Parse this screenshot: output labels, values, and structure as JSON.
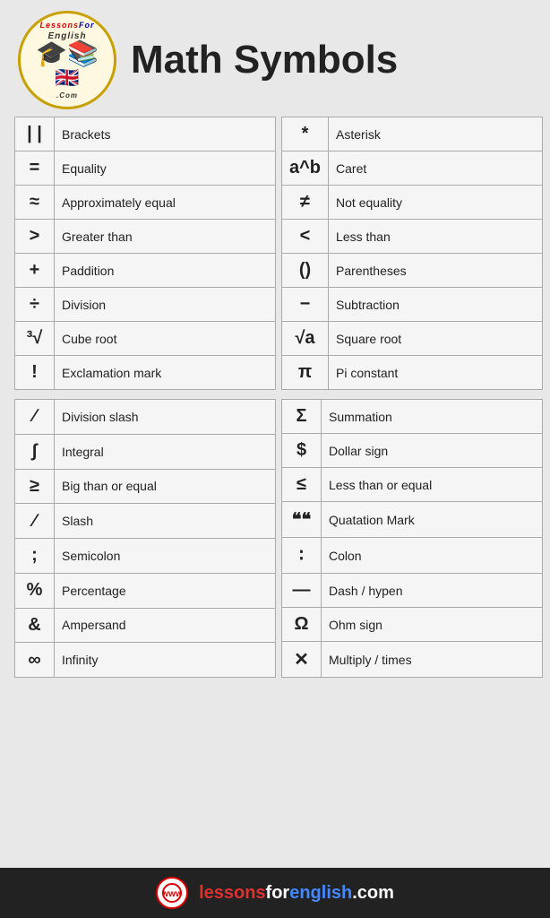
{
  "header": {
    "title": "Math Symbols",
    "logo_top": "LessonsFor",
    "logo_top2": "English",
    "logo_bottom": ".Com"
  },
  "table1_left": [
    {
      "symbol": "| |",
      "name": "Brackets"
    },
    {
      "symbol": "=",
      "name": "Equality"
    },
    {
      "symbol": "≈",
      "name": "Approximately equal"
    },
    {
      "symbol": ">",
      "name": "Greater than"
    },
    {
      "symbol": "+",
      "name": "Paddition"
    },
    {
      "symbol": "÷",
      "name": "Division"
    },
    {
      "symbol": "³√",
      "name": "Cube root"
    },
    {
      "symbol": "!",
      "name": "Exclamation mark"
    }
  ],
  "table1_right": [
    {
      "symbol": "*",
      "name": "Asterisk"
    },
    {
      "symbol": "a^b",
      "name": "Caret"
    },
    {
      "symbol": "≠",
      "name": "Not equality"
    },
    {
      "symbol": "<",
      "name": "Less than"
    },
    {
      "symbol": "()",
      "name": "Parentheses"
    },
    {
      "symbol": "−",
      "name": "Subtraction"
    },
    {
      "symbol": "√a",
      "name": "Square root"
    },
    {
      "symbol": "π",
      "name": "Pi constant"
    }
  ],
  "table2_left": [
    {
      "symbol": "∕",
      "name": "Division slash"
    },
    {
      "symbol": "∫",
      "name": "Integral"
    },
    {
      "symbol": "≥",
      "name": "Big than or equal"
    },
    {
      "symbol": "∕",
      "name": "Slash"
    },
    {
      "symbol": ";",
      "name": "Semicolon"
    },
    {
      "symbol": "%",
      "name": "Percentage"
    },
    {
      "symbol": "&",
      "name": "Ampersand"
    },
    {
      "symbol": "∞",
      "name": "Infinity"
    }
  ],
  "table2_right": [
    {
      "symbol": "Σ",
      "name": "Summation"
    },
    {
      "symbol": "$",
      "name": "Dollar sign"
    },
    {
      "symbol": "≤",
      "name": "Less than or equal"
    },
    {
      "symbol": "❝❝",
      "name": "Quatation Mark"
    },
    {
      "symbol": "∶",
      "name": "Colon"
    },
    {
      "symbol": "—",
      "name": "Dash / hypen"
    },
    {
      "symbol": "Ω",
      "name": "Ohm sign"
    },
    {
      "symbol": "✕",
      "name": "Multiply / times"
    }
  ],
  "footer": {
    "url": "lessonsforenglish.com"
  }
}
